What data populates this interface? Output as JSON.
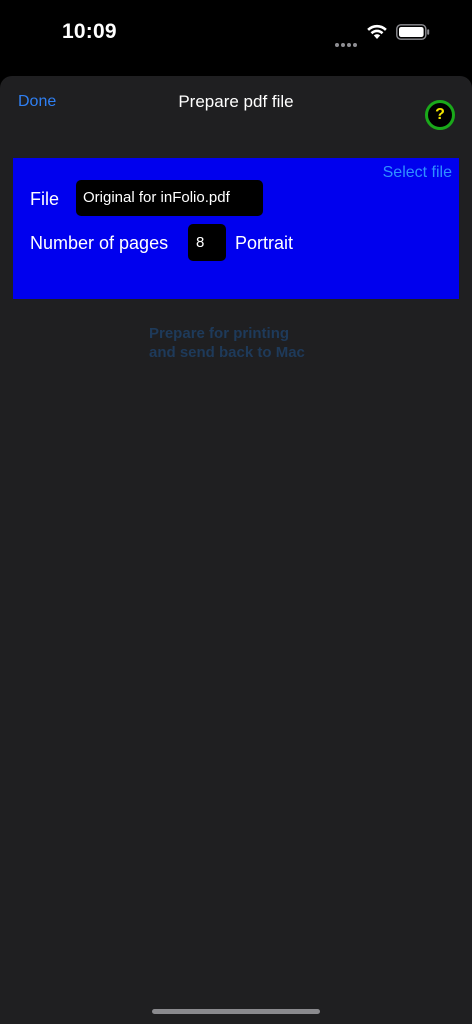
{
  "status_bar": {
    "time": "10:09",
    "icons": [
      "signal-dots-icon",
      "wifi-icon",
      "battery-icon"
    ]
  },
  "sheet": {
    "done_label": "Done",
    "title": "Prepare pdf file",
    "help_label": "?"
  },
  "file_panel": {
    "select_file_label": "Select file",
    "file_label": "File",
    "file_name": "Original for inFolio.pdf",
    "pages_label": "Number of pages",
    "pages_value": "8",
    "orientation": "Portrait"
  },
  "prepare_button": {
    "line1": "Prepare for printing",
    "line2": "and send back to Mac"
  },
  "colors": {
    "accent": "#2f7ff2",
    "panel_background": "#0000ee",
    "help_ring": "#1aa91a",
    "help_glyph": "#f2e600",
    "disabled_text": "#1e3a5a"
  }
}
